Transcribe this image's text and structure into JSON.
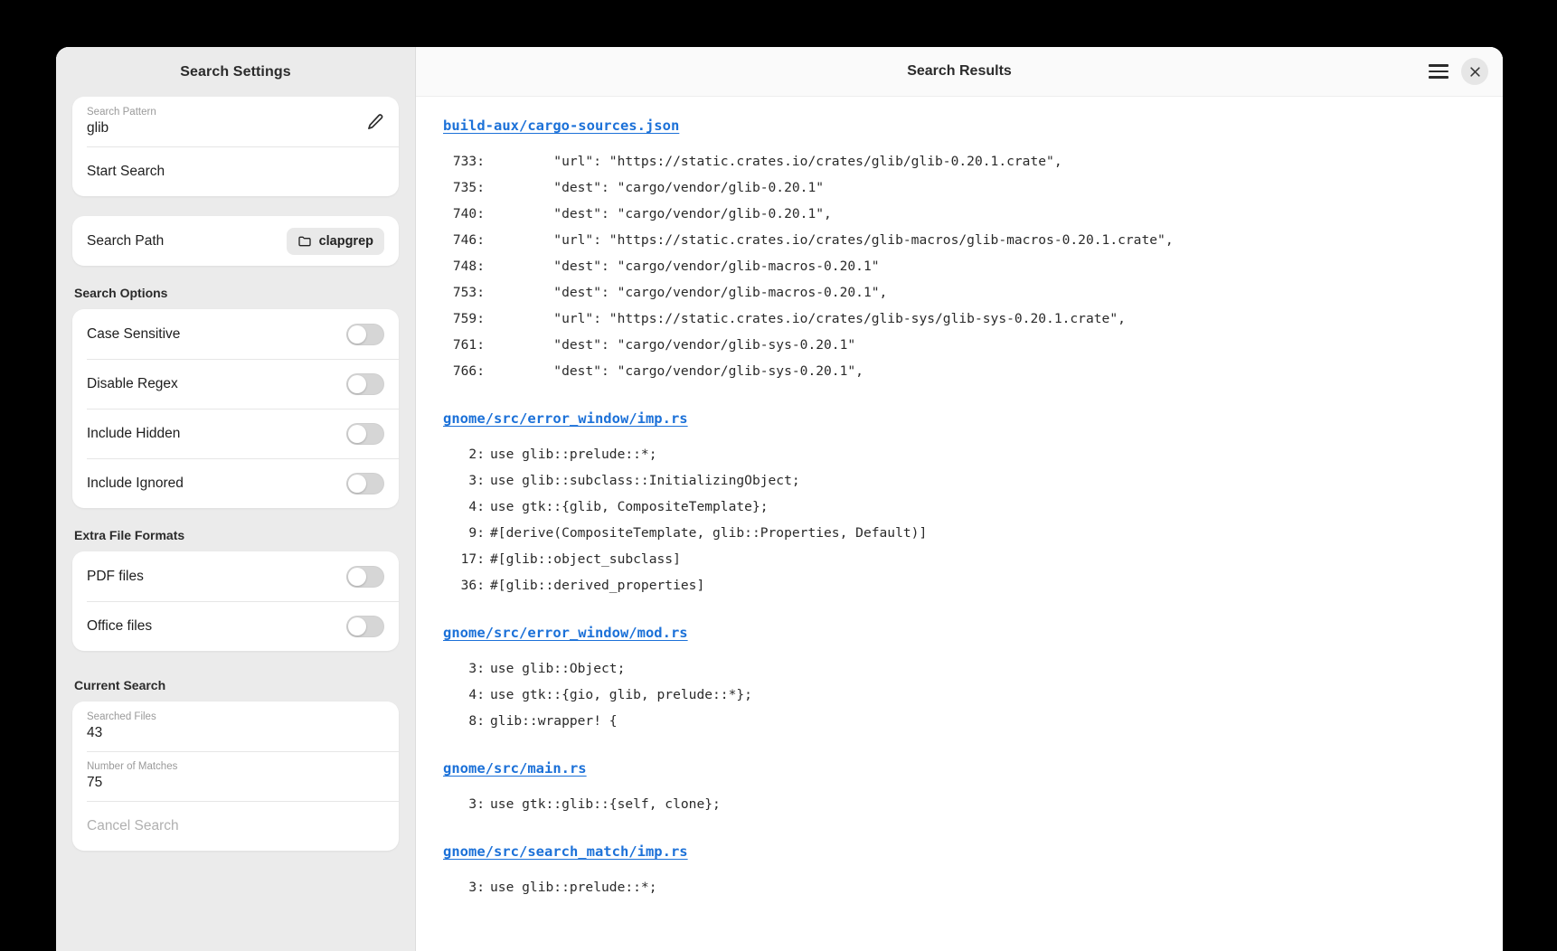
{
  "sidebar": {
    "title": "Search Settings",
    "pattern": {
      "label": "Search Pattern",
      "value": "glib",
      "edit_icon": "pencil-icon"
    },
    "start_search_label": "Start Search",
    "search_path": {
      "label": "Search Path",
      "value": "clapgrep",
      "icon": "folder-icon"
    },
    "search_options_title": "Search Options",
    "search_options": [
      {
        "label": "Case Sensitive",
        "enabled": false
      },
      {
        "label": "Disable Regex",
        "enabled": false
      },
      {
        "label": "Include Hidden",
        "enabled": false
      },
      {
        "label": "Include Ignored",
        "enabled": false
      }
    ],
    "extra_formats_title": "Extra File Formats",
    "extra_formats": [
      {
        "label": "PDF files",
        "enabled": false
      },
      {
        "label": "Office files",
        "enabled": false
      }
    ],
    "current_search_title": "Current Search",
    "current_search": {
      "searched_files_label": "Searched Files",
      "searched_files_value": "43",
      "matches_label": "Number of Matches",
      "matches_value": "75",
      "cancel_label": "Cancel Search"
    }
  },
  "content": {
    "title": "Search Results",
    "menu_icon": "hamburger-menu-icon",
    "close_icon": "close-icon",
    "results": [
      {
        "path": "build-aux/cargo-sources.json",
        "matches": [
          {
            "line": "733:",
            "text": "        \"url\": \"https://static.crates.io/crates/glib/glib-0.20.1.crate\","
          },
          {
            "line": "735:",
            "text": "        \"dest\": \"cargo/vendor/glib-0.20.1\""
          },
          {
            "line": "740:",
            "text": "        \"dest\": \"cargo/vendor/glib-0.20.1\","
          },
          {
            "line": "746:",
            "text": "        \"url\": \"https://static.crates.io/crates/glib-macros/glib-macros-0.20.1.crate\","
          },
          {
            "line": "748:",
            "text": "        \"dest\": \"cargo/vendor/glib-macros-0.20.1\""
          },
          {
            "line": "753:",
            "text": "        \"dest\": \"cargo/vendor/glib-macros-0.20.1\","
          },
          {
            "line": "759:",
            "text": "        \"url\": \"https://static.crates.io/crates/glib-sys/glib-sys-0.20.1.crate\","
          },
          {
            "line": "761:",
            "text": "        \"dest\": \"cargo/vendor/glib-sys-0.20.1\""
          },
          {
            "line": "766:",
            "text": "        \"dest\": \"cargo/vendor/glib-sys-0.20.1\","
          }
        ]
      },
      {
        "path": "gnome/src/error_window/imp.rs",
        "matches": [
          {
            "line": "2:",
            "text": "use glib::prelude::*;"
          },
          {
            "line": "3:",
            "text": "use glib::subclass::InitializingObject;"
          },
          {
            "line": "4:",
            "text": "use gtk::{glib, CompositeTemplate};"
          },
          {
            "line": "9:",
            "text": "#[derive(CompositeTemplate, glib::Properties, Default)]"
          },
          {
            "line": "17:",
            "text": "#[glib::object_subclass]"
          },
          {
            "line": "36:",
            "text": "#[glib::derived_properties]"
          }
        ]
      },
      {
        "path": "gnome/src/error_window/mod.rs",
        "matches": [
          {
            "line": "3:",
            "text": "use glib::Object;"
          },
          {
            "line": "4:",
            "text": "use gtk::{gio, glib, prelude::*};"
          },
          {
            "line": "8:",
            "text": "glib::wrapper! {"
          }
        ]
      },
      {
        "path": "gnome/src/main.rs",
        "matches": [
          {
            "line": "3:",
            "text": "use gtk::glib::{self, clone};"
          }
        ]
      },
      {
        "path": "gnome/src/search_match/imp.rs",
        "matches": [
          {
            "line": "3:",
            "text": "use glib::prelude::*;"
          }
        ]
      }
    ]
  },
  "colors": {
    "link": "#1c71d8",
    "sidebar_bg": "#ebebeb",
    "card_bg": "#ffffff",
    "toggle_off": "#d6d6d6"
  }
}
